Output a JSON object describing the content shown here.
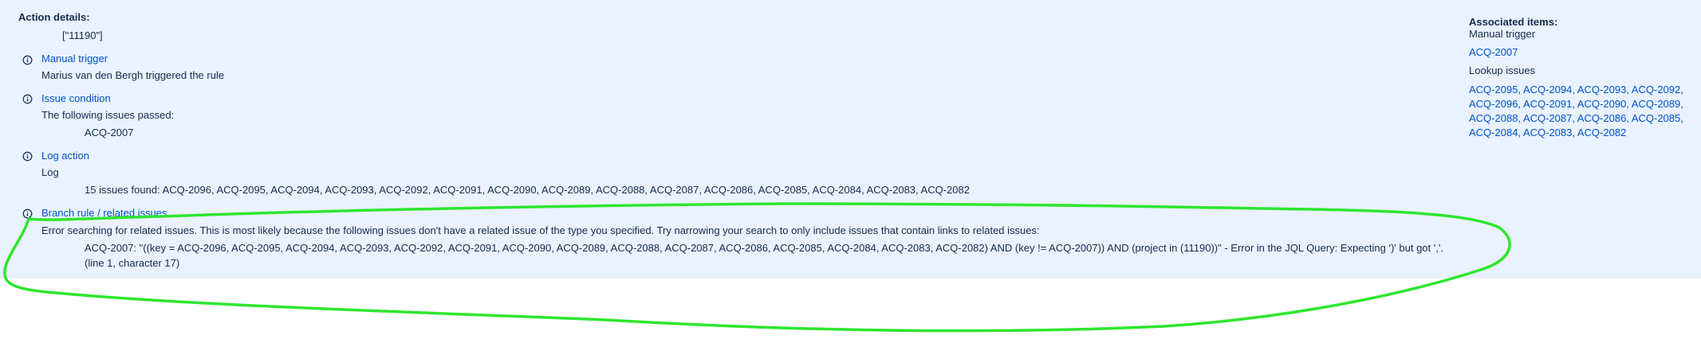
{
  "action_details": {
    "heading": "Action details:",
    "value": "[\"11190\"]"
  },
  "manual_trigger": {
    "title": "Manual trigger",
    "description": "Marius van den Bergh triggered the rule"
  },
  "issue_condition": {
    "title": "Issue condition",
    "description": "The following issues passed:",
    "issue": "ACQ-2007"
  },
  "log_action": {
    "title": "Log action",
    "description": "Log",
    "message": "15 issues found: ACQ-2096, ACQ-2095, ACQ-2094, ACQ-2093, ACQ-2092, ACQ-2091, ACQ-2090, ACQ-2089, ACQ-2088, ACQ-2087, ACQ-2086, ACQ-2085, ACQ-2084, ACQ-2083, ACQ-2082"
  },
  "branch_rule": {
    "title": "Branch rule / related issues",
    "error": "Error searching for related issues. This is most likely because the following issues don't have a related issue of the type you specified. Try narrowing your search to only include issues that contain links to related issues:",
    "detail": "ACQ-2007: \"((key = ACQ-2096, ACQ-2095, ACQ-2094, ACQ-2093, ACQ-2092, ACQ-2091, ACQ-2090, ACQ-2089, ACQ-2088, ACQ-2087, ACQ-2086, ACQ-2085, ACQ-2084, ACQ-2083, ACQ-2082) AND (key != ACQ-2007)) AND (project in (11190))\" - Error in the JQL Query: Expecting ')' but got ','. (line 1, character 17)"
  },
  "associated_items": {
    "heading": "Associated items:",
    "manual_trigger_label": "Manual trigger",
    "manual_trigger_issue": "ACQ-2007",
    "lookup_label": "Lookup issues",
    "lookup_issues": [
      "ACQ-2095",
      "ACQ-2094",
      "ACQ-2093",
      "ACQ-2092",
      "ACQ-2096",
      "ACQ-2091",
      "ACQ-2090",
      "ACQ-2089",
      "ACQ-2088",
      "ACQ-2087",
      "ACQ-2086",
      "ACQ-2085",
      "ACQ-2084",
      "ACQ-2083",
      "ACQ-2082"
    ]
  },
  "colors": {
    "panel_background": "#e9f2fe",
    "link": "#0052cc",
    "text": "#172b4d",
    "annotation": "#2ee62e"
  },
  "icons": {
    "info": "info-circle-icon"
  }
}
